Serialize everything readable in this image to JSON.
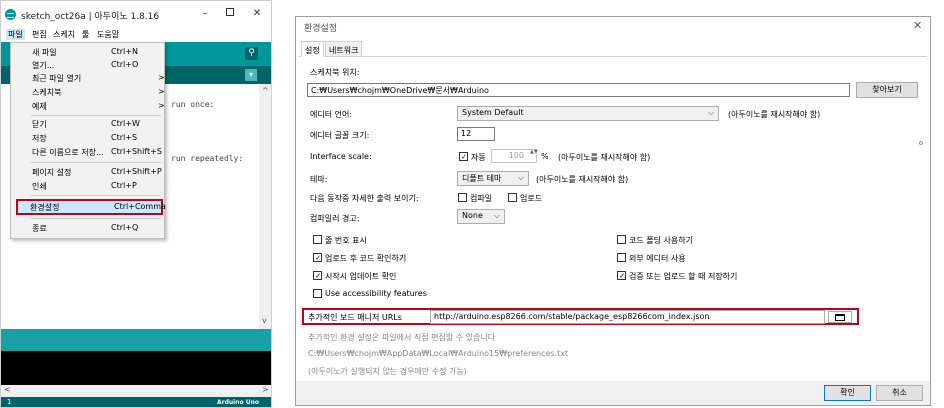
{
  "ide": {
    "title": "sketch_oct26a | 아두이노 1.8.16",
    "window_buttons": {
      "minimize": "–",
      "close": "✕"
    },
    "menubar": [
      "파일",
      "편집",
      "스케치",
      "툴",
      "도움말"
    ],
    "code_lines": [
      "run once:",
      "run repeatedly:"
    ],
    "serial_monitor_glyph": "⚲",
    "tab_menu_glyph": "▾",
    "footer_line": "1",
    "footer_board": "Arduino Uno",
    "scroll_glyphs": {
      "up": "^",
      "down": "v",
      "left": "<",
      "right": ">"
    }
  },
  "file_menu": {
    "items": [
      {
        "label": "새 파일",
        "shortcut": "Ctrl+N"
      },
      {
        "label": "열기...",
        "shortcut": "Ctrl+O"
      },
      {
        "label": "최근 파일 열기",
        "arrow": ">"
      },
      {
        "label": "스케치북",
        "arrow": ">"
      },
      {
        "label": "예제",
        "arrow": ">"
      },
      {
        "label": "닫기",
        "shortcut": "Ctrl+W"
      },
      {
        "label": "저장",
        "shortcut": "Ctrl+S"
      },
      {
        "label": "다른 이름으로 저장...",
        "shortcut": "Ctrl+Shift+S"
      },
      {
        "label": "페이지 설정",
        "shortcut": "Ctrl+Shift+P"
      },
      {
        "label": "인쇄",
        "shortcut": "Ctrl+P"
      },
      {
        "label": "환경설정",
        "shortcut": "Ctrl+Comma"
      },
      {
        "label": "종료",
        "shortcut": "Ctrl+Q"
      }
    ]
  },
  "prefs": {
    "title": "환경설정",
    "close": "✕",
    "tabs": [
      "설정",
      "네트워크"
    ],
    "sketchbook_label": "스케치북 위치:",
    "sketchbook_path": "C:₩Users₩chojm₩OneDrive₩문서₩Arduino",
    "browse_button": "찾아보기",
    "editor_lang_label": "에디터 언어:",
    "editor_lang_value": "System Default",
    "restart_note": "(아두이노를 재시작해야 함)",
    "font_size_label": "에디터 글꼴 크기:",
    "font_size_value": "12",
    "interface_scale_label": "Interface scale:",
    "auto_label": "자동",
    "scale_value": "100",
    "scale_spin": "▲▼",
    "percent": "%",
    "theme_label": "테마:",
    "theme_value": "디폴트 테마",
    "verbose_label": "다음 동작중 자세한 출력 보이기:",
    "verbose_compile": "컴파일",
    "verbose_upload": "업로드",
    "compiler_warn_label": "컴파일러 경고:",
    "compiler_warn_value": "None",
    "chevron": "⌵",
    "checkboxes_left": [
      {
        "label": "줄 번호 표시",
        "checked": false
      },
      {
        "label": "업로드 후 코드 확인하기",
        "checked": true
      },
      {
        "label": "시작시 업데이트 확인",
        "checked": true
      },
      {
        "label": "Use accessibility features",
        "checked": false
      }
    ],
    "checkboxes_right": [
      {
        "label": "코드 폴딩 사용하기",
        "checked": false
      },
      {
        "label": "외부 에디터 사용",
        "checked": false
      },
      {
        "label": "검증 또는 업로드 할 때 저장하기",
        "checked": true
      }
    ],
    "board_urls_label": "추가적인 보드 매니저 URLs",
    "board_urls_value": "http://arduino.esp8266.com/stable/package_esp8266com_index.json",
    "more_prefs_note": "추가적인 환경 설정은 파일에서 직접 편집할 수 있습니다",
    "prefs_path": "C:₩Users₩chojm₩AppData₩Local₩Arduino15₩preferences.txt",
    "edit_note": "(아두이노가 실행되지 않는 경우에만 수정 가능)",
    "ok_button": "확인",
    "cancel_button": "취소"
  }
}
